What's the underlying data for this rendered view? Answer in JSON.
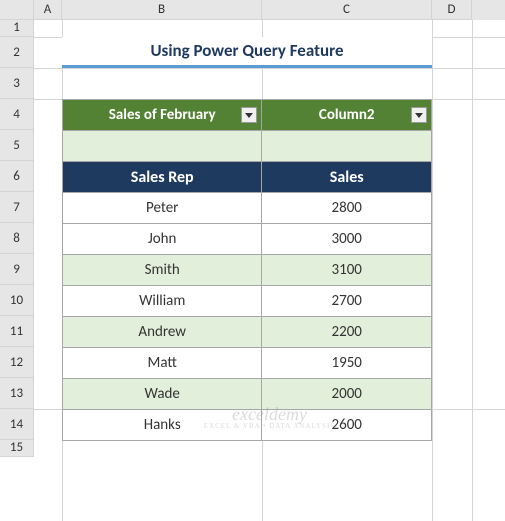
{
  "columns": {
    "A": "A",
    "B": "B",
    "C": "C",
    "D": "D"
  },
  "rows": [
    "1",
    "2",
    "3",
    "4",
    "5",
    "6",
    "7",
    "8",
    "9",
    "10",
    "11",
    "12",
    "13",
    "14",
    "15"
  ],
  "title": "Using Power Query Feature",
  "tableHeaders": {
    "col1": "Sales of February",
    "col2": "Column2"
  },
  "subHeaders": {
    "col1": "Sales Rep",
    "col2": "Sales"
  },
  "data": [
    {
      "rep": "Peter",
      "sales": "2800"
    },
    {
      "rep": "John",
      "sales": "3000"
    },
    {
      "rep": "Smith",
      "sales": "3100"
    },
    {
      "rep": "William",
      "sales": "2700"
    },
    {
      "rep": "Andrew",
      "sales": "2200"
    },
    {
      "rep": "Matt",
      "sales": "1950"
    },
    {
      "rep": "Wade",
      "sales": "2000"
    },
    {
      "rep": "Hanks",
      "sales": "2600"
    }
  ],
  "watermark": {
    "main": "exceldemy",
    "sub": "EXCEL & VBA • DATA ANALYSIS"
  },
  "chart_data": {
    "type": "table",
    "title": "Using Power Query Feature",
    "columns": [
      "Sales Rep",
      "Sales"
    ],
    "rows": [
      [
        "Peter",
        2800
      ],
      [
        "John",
        3000
      ],
      [
        "Smith",
        3100
      ],
      [
        "William",
        2700
      ],
      [
        "Andrew",
        2200
      ],
      [
        "Matt",
        1950
      ],
      [
        "Wade",
        2000
      ],
      [
        "Hanks",
        2600
      ]
    ]
  }
}
